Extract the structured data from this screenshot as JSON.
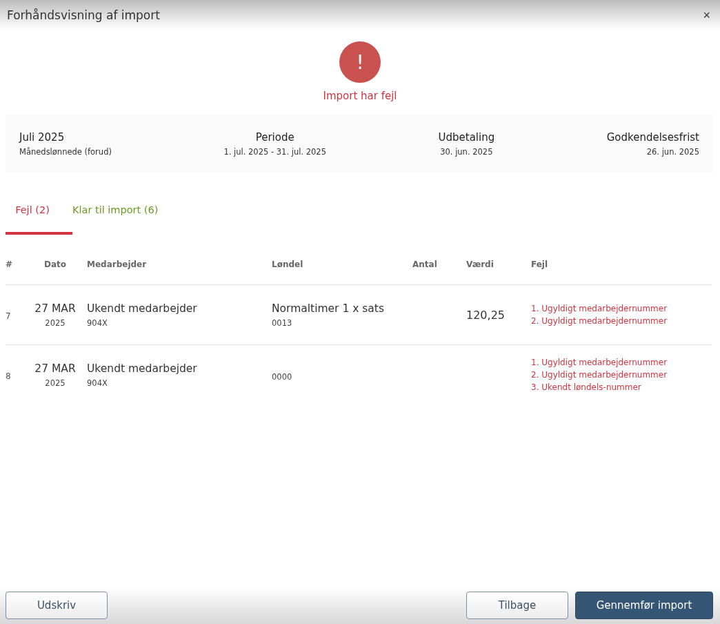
{
  "window": {
    "title": "Forhåndsvisning af import",
    "close": "×"
  },
  "status": {
    "icon": "!",
    "message": "Import har fejl"
  },
  "summary": [
    {
      "title": "Juli 2025",
      "detail": "Månedslønnede (forud)"
    },
    {
      "title": "Periode",
      "detail": "1. jul. 2025 - 31. jul. 2025"
    },
    {
      "title": "Udbetaling",
      "detail": "30. jun. 2025"
    },
    {
      "title": "Godkendelsesfrist",
      "detail": "26. jun. 2025"
    }
  ],
  "tabs": [
    {
      "label": "Fejl (2)",
      "selected": true,
      "color": "#d2343f"
    },
    {
      "label": "Klar til import (6)",
      "selected": false,
      "color": "#6a9a1f"
    }
  ],
  "table": {
    "columns": [
      "#",
      "Dato",
      "Medarbejder",
      "Løndel",
      "Antal",
      "Værdi",
      "Fejl"
    ],
    "rows": [
      {
        "number": "7",
        "date": "27 MAR",
        "year": "2025",
        "employee": "Ukendt medarbejder",
        "employee_number": "904X",
        "wage_type": "Normaltimer 1 x sats",
        "wage_code": "0013",
        "value": "120,25",
        "errors": [
          "1. Ugyldigt medarbejdernummer",
          "2. Ugyldigt medarbejdernummer"
        ]
      },
      {
        "number": "8",
        "date": "27 MAR",
        "year": "2025",
        "employee": "Ukendt medarbejder",
        "employee_number": "904X",
        "wage_code": "0000",
        "errors": [
          "1. Ugyldigt medarbejdernummer",
          "2. Ugyldigt medarbejdernummer",
          "3. Ukendt løndels-nummer"
        ]
      }
    ]
  },
  "buttons": [
    {
      "label": "Udskriv",
      "kind": "secondary"
    },
    {
      "label": "Tilbage",
      "kind": "secondary"
    },
    {
      "label": "Gennemfør import",
      "kind": "primary"
    }
  ]
}
